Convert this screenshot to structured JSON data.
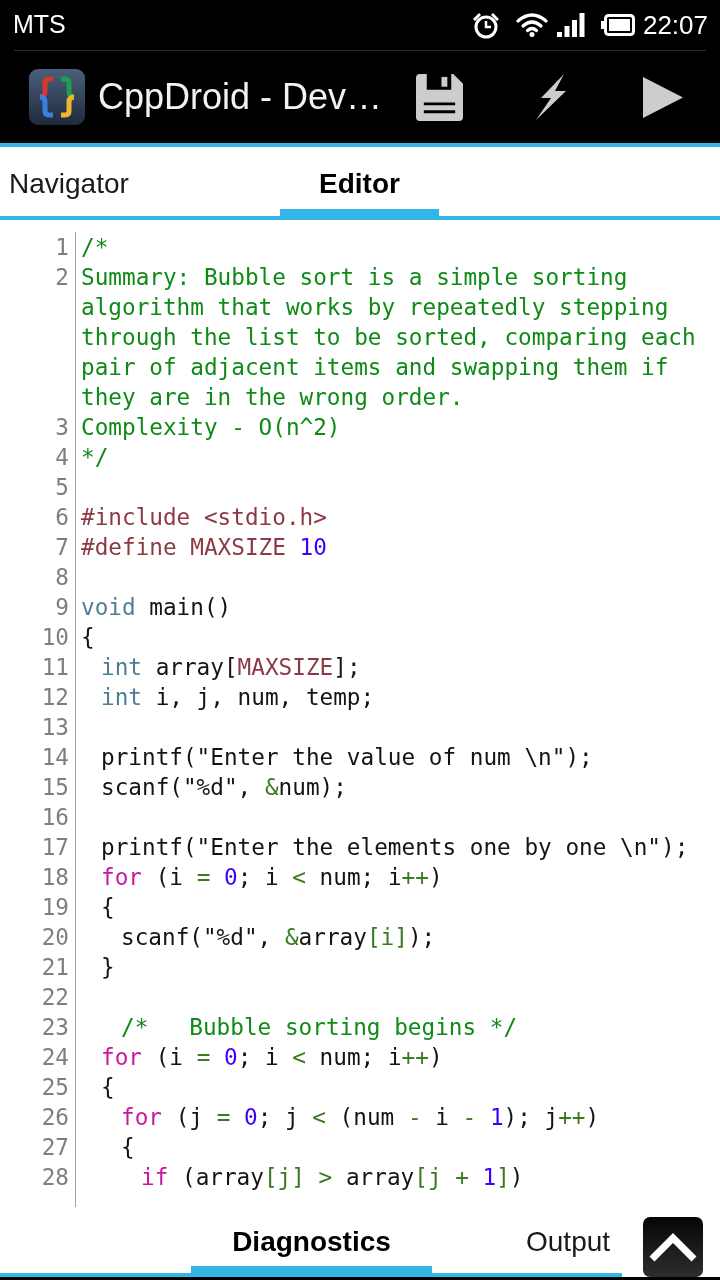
{
  "status_bar": {
    "carrier": "MTS",
    "time": "22:07"
  },
  "action_bar": {
    "title": "CppDroid - Dev…"
  },
  "top_tabs": [
    {
      "label": "Navigator",
      "selected": false
    },
    {
      "label": "Editor",
      "selected": true
    }
  ],
  "editor": {
    "lines": [
      {
        "number": "1",
        "tokens": [
          {
            "kind": "comment",
            "text": "/*"
          }
        ]
      },
      {
        "number": "2",
        "tokens": [
          {
            "kind": "comment",
            "text": "Summary: Bubble sort is a simple sorting algorithm that works by repeatedly stepping through the list to be sorted, comparing each pair of adjacent items and swapping them if they are in the wrong order."
          }
        ]
      },
      {
        "number": "3",
        "tokens": [
          {
            "kind": "comment",
            "text": "Complexity - O(n^2)"
          }
        ]
      },
      {
        "number": "4",
        "tokens": [
          {
            "kind": "comment",
            "text": "*/"
          }
        ]
      },
      {
        "number": "5"
      },
      {
        "number": "6",
        "tokens": [
          {
            "kind": "preprocessor",
            "text": "#include <stdio.h>"
          }
        ]
      },
      {
        "number": "7",
        "tokens": [
          {
            "kind": "preprocessor",
            "text": "#define MAXSIZE "
          },
          {
            "kind": "number",
            "text": "10"
          }
        ]
      },
      {
        "number": "8"
      },
      {
        "number": "9",
        "tokens": [
          {
            "kind": "type",
            "text": "void"
          },
          {
            "kind": "plain",
            "text": " main()"
          }
        ]
      },
      {
        "number": "10",
        "tokens": [
          {
            "kind": "plain",
            "text": "{"
          }
        ]
      },
      {
        "number": "11",
        "tokens": [
          {
            "kind": "type",
            "text": "\tint"
          },
          {
            "kind": "plain",
            "text": " array["
          },
          {
            "kind": "preprocessor",
            "text": "MAXSIZE"
          },
          {
            "kind": "plain",
            "text": "];"
          }
        ]
      },
      {
        "number": "12",
        "tokens": [
          {
            "kind": "type",
            "text": "\tint"
          },
          {
            "kind": "plain",
            "text": " i, j, num, temp;"
          }
        ]
      },
      {
        "number": "13"
      },
      {
        "number": "14",
        "tokens": [
          {
            "kind": "plain",
            "text": "\tprintf(\"Enter the value of num \\n\");"
          }
        ]
      },
      {
        "number": "15",
        "tokens": [
          {
            "kind": "plain",
            "text": "\tscanf(\"%d\", "
          },
          {
            "kind": "operator",
            "text": "&"
          },
          {
            "kind": "plain",
            "text": "num);"
          }
        ]
      },
      {
        "number": "16"
      },
      {
        "number": "17",
        "tokens": [
          {
            "kind": "plain",
            "text": "\tprintf(\"Enter the elements one by one \\n\");"
          }
        ]
      },
      {
        "number": "18",
        "tokens": [
          {
            "kind": "keyword",
            "text": "\tfor"
          },
          {
            "kind": "plain",
            "text": " (i "
          },
          {
            "kind": "operator",
            "text": "= "
          },
          {
            "kind": "number",
            "text": "0"
          },
          {
            "kind": "plain",
            "text": "; i "
          },
          {
            "kind": "operator",
            "text": "<"
          },
          {
            "kind": "plain",
            "text": " num; i"
          },
          {
            "kind": "operator",
            "text": "++"
          },
          {
            "kind": "plain",
            "text": ")"
          }
        ]
      },
      {
        "number": "19",
        "tokens": [
          {
            "kind": "plain",
            "text": "\t{"
          }
        ]
      },
      {
        "number": "20",
        "tokens": [
          {
            "kind": "plain",
            "text": "\t\tscanf(\"%d\", "
          },
          {
            "kind": "operator",
            "text": "&"
          },
          {
            "kind": "plain",
            "text": "array"
          },
          {
            "kind": "operator",
            "text": "[i]"
          },
          {
            "kind": "plain",
            "text": ");"
          }
        ]
      },
      {
        "number": "21",
        "tokens": [
          {
            "kind": "plain",
            "text": "\t}"
          }
        ]
      },
      {
        "number": "22"
      },
      {
        "number": "23",
        "tokens": [
          {
            "kind": "comment",
            "text": "\t\t/*   Bubble sorting begins */"
          }
        ]
      },
      {
        "number": "24",
        "tokens": [
          {
            "kind": "keyword",
            "text": "\tfor"
          },
          {
            "kind": "plain",
            "text": " (i "
          },
          {
            "kind": "operator",
            "text": "= "
          },
          {
            "kind": "number",
            "text": "0"
          },
          {
            "kind": "plain",
            "text": "; i "
          },
          {
            "kind": "operator",
            "text": "<"
          },
          {
            "kind": "plain",
            "text": " num; i"
          },
          {
            "kind": "operator",
            "text": "++"
          },
          {
            "kind": "plain",
            "text": ")"
          }
        ]
      },
      {
        "number": "25",
        "tokens": [
          {
            "kind": "plain",
            "text": "\t{"
          }
        ]
      },
      {
        "number": "26",
        "tokens": [
          {
            "kind": "keyword",
            "text": "\t\tfor"
          },
          {
            "kind": "plain",
            "text": " (j "
          },
          {
            "kind": "operator",
            "text": "= "
          },
          {
            "kind": "number",
            "text": "0"
          },
          {
            "kind": "plain",
            "text": "; j "
          },
          {
            "kind": "operator",
            "text": "<"
          },
          {
            "kind": "plain",
            "text": " (num "
          },
          {
            "kind": "operator",
            "text": "-"
          },
          {
            "kind": "plain",
            "text": " i "
          },
          {
            "kind": "operator",
            "text": "- "
          },
          {
            "kind": "number",
            "text": "1"
          },
          {
            "kind": "plain",
            "text": "); j"
          },
          {
            "kind": "operator",
            "text": "++"
          },
          {
            "kind": "plain",
            "text": ")"
          }
        ]
      },
      {
        "number": "27",
        "tokens": [
          {
            "kind": "plain",
            "text": "\t\t{"
          }
        ]
      },
      {
        "number": "28",
        "tokens": [
          {
            "kind": "keyword",
            "text": "\t\t\tif"
          },
          {
            "kind": "plain",
            "text": " (array"
          },
          {
            "kind": "operator",
            "text": "[j] >"
          },
          {
            "kind": "plain",
            "text": " array"
          },
          {
            "kind": "operator",
            "text": "[j + "
          },
          {
            "kind": "number",
            "text": "1"
          },
          {
            "kind": "operator",
            "text": "]"
          },
          {
            "kind": "plain",
            "text": ")"
          }
        ]
      }
    ]
  },
  "bottom_tabs": [
    {
      "label": "Diagnostics",
      "selected": true
    },
    {
      "label": "Output",
      "selected": false
    }
  ]
}
